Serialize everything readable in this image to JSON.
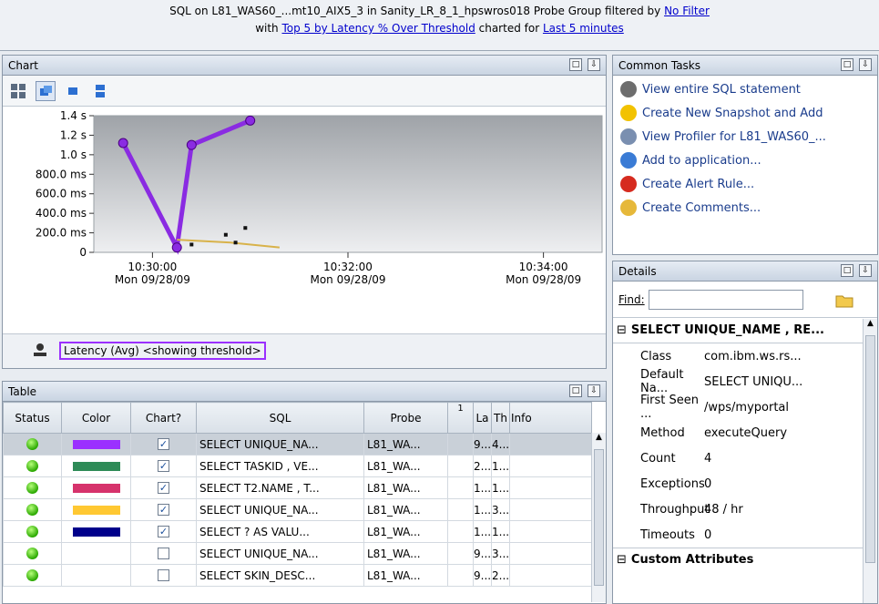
{
  "header": {
    "line1_prefix": "SQL on L81_WAS60_...mt10_AIX5_3 in Sanity_LR_8_1_hpswros018 Probe Group filtered by ",
    "line1_link": "No Filter",
    "line2_prefix": "with ",
    "line2_link1": "Top 5 by Latency % Over Threshold",
    "line2_mid": " charted for ",
    "line2_link2": "Last 5 minutes"
  },
  "chart_panel": {
    "title": "Chart",
    "legend_label": "Latency (Avg) <showing threshold>"
  },
  "chart_data": {
    "type": "line",
    "y_ticks": [
      "1.4 s",
      "1.2 s",
      "1.0 s",
      "800.0 ms",
      "600.0 ms",
      "400.0 ms",
      "200.0 ms",
      "0"
    ],
    "x_ticks": [
      {
        "time": "10:30:00",
        "date": "Mon 09/28/09"
      },
      {
        "time": "10:32:00",
        "date": "Mon 09/28/09"
      },
      {
        "time": "10:34:00",
        "date": "Mon 09/28/09"
      }
    ],
    "ylim_s": [
      0,
      1.4
    ],
    "series": [
      {
        "color": "#8a2be2",
        "points": [
          [
            -0.3,
            1.12
          ],
          [
            0.25,
            0.05
          ],
          [
            0.4,
            1.1
          ],
          [
            1.0,
            1.35
          ]
        ]
      },
      {
        "color": "#d8b24a",
        "points": [
          [
            0.25,
            0.13
          ],
          [
            0.8,
            0.1
          ],
          [
            1.3,
            0.05
          ]
        ]
      }
    ],
    "scatter": [
      [
        0.4,
        0.08
      ],
      [
        0.75,
        0.18
      ],
      [
        0.95,
        0.25
      ],
      [
        0.85,
        0.1
      ]
    ]
  },
  "common_tasks": {
    "title": "Common Tasks",
    "items": [
      {
        "label": "View entire SQL statement",
        "icon": "database-icon",
        "color": "#6d6d6d"
      },
      {
        "label": "Create New Snapshot and Add",
        "icon": "warning-icon",
        "color": "#f2c200"
      },
      {
        "label": "View Profiler for L81_WAS60_...",
        "icon": "profiler-icon",
        "color": "#7a8fb0"
      },
      {
        "label": "Add to application...",
        "icon": "add-app-icon",
        "color": "#3a7bd5"
      },
      {
        "label": "Create Alert Rule...",
        "icon": "alert-icon",
        "color": "#d62b1f"
      },
      {
        "label": "Create Comments...",
        "icon": "comment-icon",
        "color": "#e6b83a"
      }
    ]
  },
  "details": {
    "title": "Details",
    "find_label": "Find:",
    "section1": "SELECT UNIQUE_NAME , RE...",
    "rows": [
      {
        "k": "Class",
        "v": "com.ibm.ws.rs..."
      },
      {
        "k": "Default Na...",
        "v": "SELECT UNIQU..."
      },
      {
        "k": "First Seen ...",
        "v": "/wps/myportal"
      },
      {
        "k": "Method",
        "v": "executeQuery"
      },
      {
        "k": "Count",
        "v": "4"
      },
      {
        "k": "Exceptions",
        "v": "0"
      },
      {
        "k": "Throughput",
        "v": "48 / hr"
      },
      {
        "k": "Timeouts",
        "v": "0"
      }
    ],
    "section2": "Custom Attributes"
  },
  "table_panel": {
    "title": "Table",
    "columns": [
      "Status",
      "Color",
      "Chart?",
      "SQL",
      "Probe",
      "1",
      "La",
      "Th",
      "Info"
    ],
    "rows": [
      {
        "color": "#9b30ff",
        "chart": "✓",
        "sql": "SELECT UNIQUE_NA...",
        "probe": "L81_WA...",
        "la": "9...",
        "th": "4...",
        "sel": true
      },
      {
        "color": "#2e8b57",
        "chart": "✓",
        "sql": "SELECT TASKID , VE...",
        "probe": "L81_WA...",
        "la": "2...",
        "th": "1..."
      },
      {
        "color": "#d6336c",
        "chart": "✓",
        "sql": "SELECT T2.NAME , T...",
        "probe": "L81_WA...",
        "la": "1...",
        "th": "1..."
      },
      {
        "color": "#ffc832",
        "chart": "✓",
        "sql": "SELECT UNIQUE_NA...",
        "probe": "L81_WA...",
        "la": "1...",
        "th": "3..."
      },
      {
        "color": "#00008b",
        "chart": "✓",
        "sql": "SELECT ? AS VALU...",
        "probe": "L81_WA...",
        "la": "1...",
        "th": "1..."
      },
      {
        "color": "",
        "chart": "",
        "sql": "SELECT UNIQUE_NA...",
        "probe": "L81_WA...",
        "la": "9...",
        "th": "3..."
      },
      {
        "color": "",
        "chart": "",
        "sql": "SELECT SKIN_DESC...",
        "probe": "L81_WA...",
        "la": "9...",
        "th": "2..."
      }
    ]
  }
}
